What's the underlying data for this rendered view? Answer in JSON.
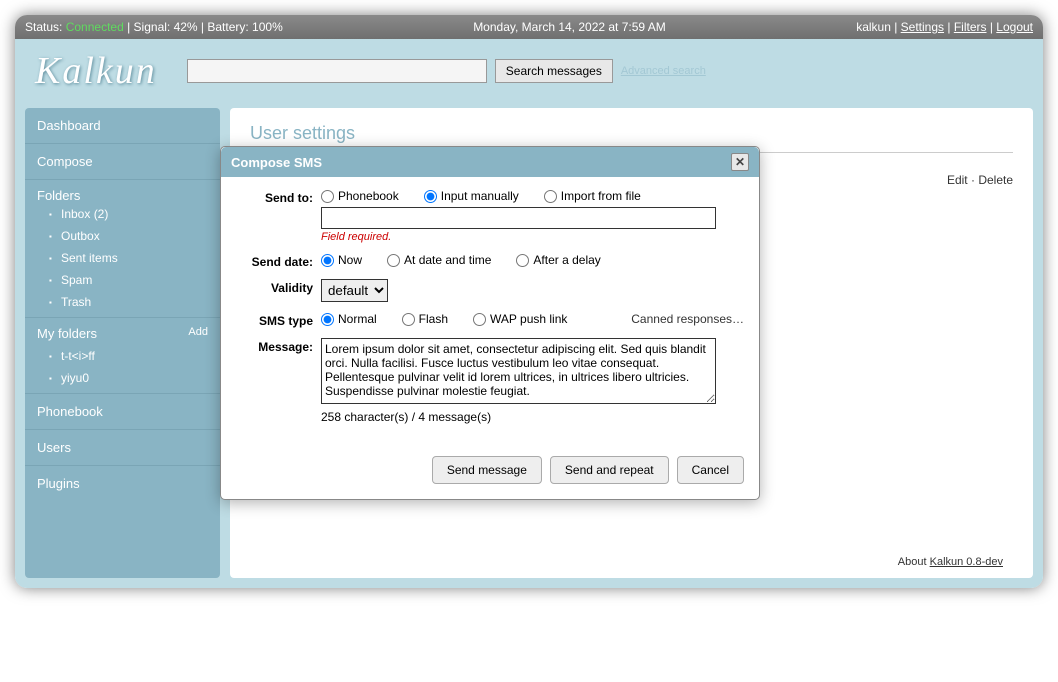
{
  "status": {
    "label": "Status:",
    "connected": "Connected",
    "signal": "| Signal: 42% | Battery: 100%",
    "datetime": "Monday, March 14, 2022 at 7:59 AM",
    "app": "kalkun",
    "settings": "Settings",
    "filters": "Filters",
    "logout": "Logout"
  },
  "search": {
    "button": "Search messages",
    "advanced": "Advanced search"
  },
  "logo": "Kalkun",
  "sidebar": {
    "dashboard": "Dashboard",
    "compose": "Compose",
    "folders": "Folders",
    "inbox": "Inbox (2)",
    "outbox": "Outbox",
    "sent": "Sent items",
    "spam": "Spam",
    "trash": "Trash",
    "myfolders": "My folders",
    "add": "Add",
    "f1": "t-t<i>ff",
    "f2": "yiyu0",
    "phonebook": "Phonebook",
    "users": "Users",
    "plugins": "Plugins"
  },
  "content": {
    "title": "User settings",
    "edit": "Edit",
    "delete": "Delete"
  },
  "dialog": {
    "title": "Compose SMS",
    "sendto": "Send to:",
    "phonebook": "Phonebook",
    "inputman": "Input manually",
    "import": "Import from file",
    "fieldreq": "Field required.",
    "senddate": "Send date:",
    "now": "Now",
    "atdate": "At date and time",
    "delay": "After a delay",
    "validity": "Validity",
    "default": "default",
    "smstype": "SMS type",
    "normal": "Normal",
    "flash": "Flash",
    "wap": "WAP push link",
    "canned": "Canned responses…",
    "message": "Message:",
    "msgtext": "Lorem ipsum dolor sit amet, consectetur adipiscing elit. Sed quis blandit orci. Nulla facilisi. Fusce luctus vestibulum leo vitae consequat. Pellentesque pulvinar velit id lorem ultrices, in ultrices libero ultricies. Suspendisse pulvinar molestie feugiat.",
    "charcount": "258 character(s) / 4 message(s)",
    "send": "Send message",
    "repeat": "Send and repeat",
    "cancel": "Cancel"
  },
  "footer": {
    "about": "About",
    "version": "Kalkun 0.8-dev"
  }
}
